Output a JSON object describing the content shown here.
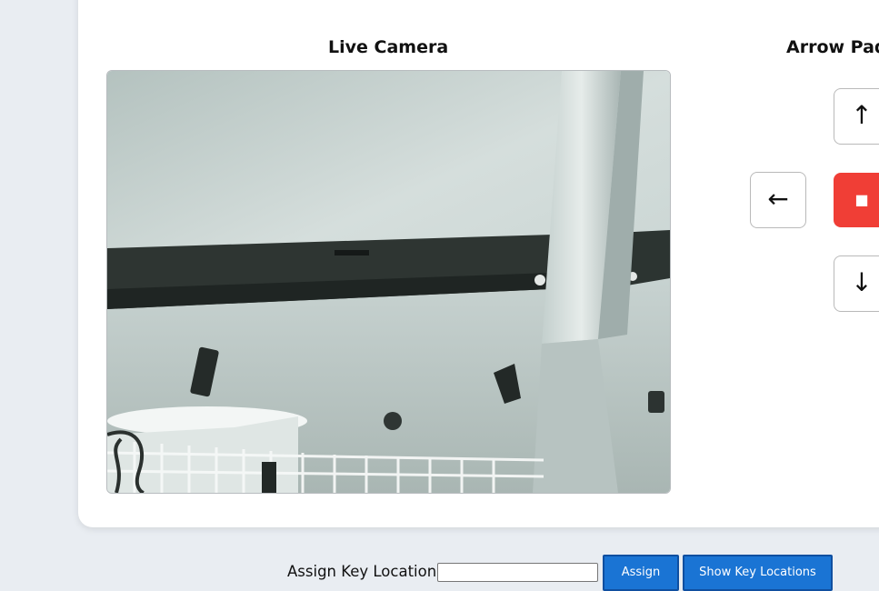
{
  "camera": {
    "title": "Live Camera"
  },
  "arrow_pad": {
    "title": "Arrow Pad",
    "up_label": "↑",
    "left_label": "←",
    "stop_label": "■",
    "down_label": "↓",
    "stop_color": "#f03e36"
  },
  "key_location": {
    "label": "Assign Key Location:",
    "input_value": "",
    "assign_button": "Assign",
    "show_button": "Show Key Locations",
    "button_color": "#1a74d4"
  }
}
